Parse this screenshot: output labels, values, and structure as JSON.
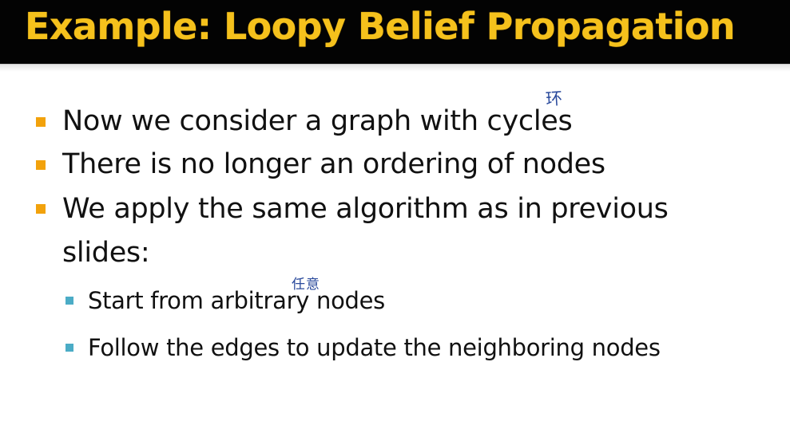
{
  "slide": {
    "title": "Example: Loopy Belief Propagation",
    "bullets": [
      "Now we consider a graph with cycles",
      "There is no longer an ordering of nodes",
      "We apply the same algorithm as in previous",
      "slides:"
    ],
    "sub_bullets": [
      "Start from arbitrary nodes",
      "Follow the edges to update the neighboring nodes"
    ],
    "annotations": {
      "cycles_note": "环",
      "arbitrary_note": "任意"
    }
  },
  "colors": {
    "title_bg": "#030303",
    "title_text": "#f5c11c",
    "bullet_main": "#f2a20c",
    "bullet_sub": "#4bacc6",
    "handwriting": "#2a4a9c"
  }
}
